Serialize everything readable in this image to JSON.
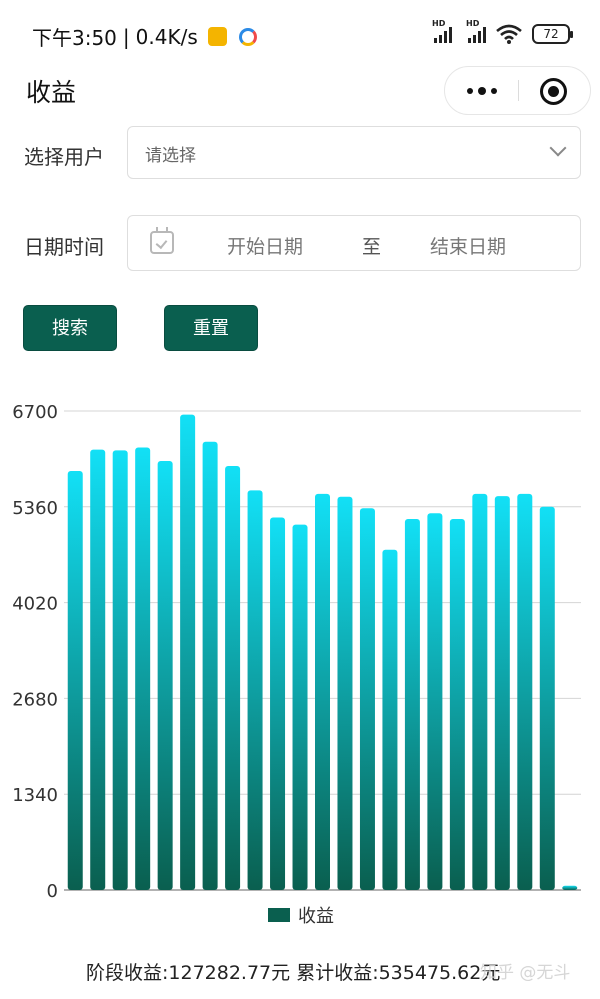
{
  "status_bar": {
    "time": "下午3:50",
    "separator": "|",
    "speed": "0.4K/s",
    "hd1": "HD",
    "hd2": "HD",
    "battery": "72"
  },
  "header": {
    "title": "收益"
  },
  "form": {
    "user_label": "选择用户",
    "user_placeholder": "请选择",
    "date_label": "日期时间",
    "start_placeholder": "开始日期",
    "date_separator": "至",
    "end_placeholder": "结束日期",
    "search_button": "搜索",
    "reset_button": "重置"
  },
  "chart_data": {
    "type": "bar",
    "ylim": [
      0,
      6700
    ],
    "ticks": [
      "0",
      "1340",
      "2680",
      "4020",
      "5360",
      "6700"
    ],
    "values": [
      5860,
      6160,
      6150,
      6190,
      6000,
      6650,
      6270,
      5930,
      5590,
      5210,
      5110,
      5540,
      5500,
      5340,
      4760,
      5190,
      5270,
      5190,
      5540,
      5510,
      5540,
      5360,
      60
    ],
    "legend": "收益",
    "colors": {
      "top": "#12e0f6",
      "bottom": "#0a5f4f",
      "legend": "#0a5f4f"
    },
    "grid": true
  },
  "summary": {
    "text": "阶段收益:127282.77元 累计收益:535475.62元"
  },
  "watermark": "知乎 @无斗"
}
